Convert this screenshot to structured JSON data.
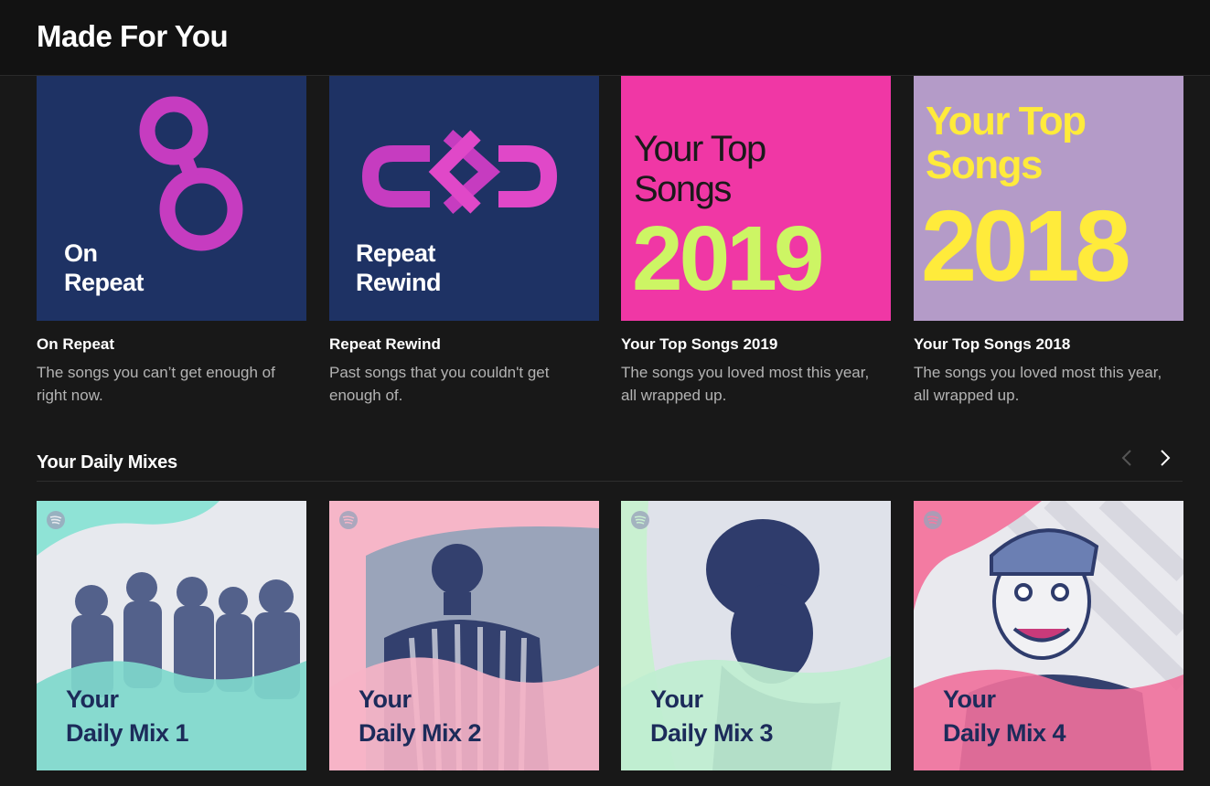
{
  "header": {
    "title": "Made For You"
  },
  "playlists": [
    {
      "title": "On Repeat",
      "description": "The songs you can’t get enough of right now.",
      "cover_line1": "On",
      "cover_line2": "Repeat"
    },
    {
      "title": "Repeat Rewind",
      "description": "Past songs that you couldn't get enough of.",
      "cover_line1": "Repeat",
      "cover_line2": "Rewind"
    },
    {
      "title": "Your Top Songs 2019",
      "description": "The songs you loved most this year, all wrapped up.",
      "cover_line1": "Your Top",
      "cover_line2": "Songs",
      "cover_year": "2019"
    },
    {
      "title": "Your Top Songs 2018",
      "description": "The songs you loved most this year, all wrapped up.",
      "cover_line1": "Your Top",
      "cover_line2": "Songs",
      "cover_year": "2018"
    }
  ],
  "daily_mixes": {
    "title": "Your Daily Mixes",
    "prev_icon": "chevron-left-icon",
    "next_icon": "chevron-right-icon",
    "items": [
      {
        "line1": "Your",
        "line2": "Daily Mix 1"
      },
      {
        "line1": "Your",
        "line2": "Daily Mix 2"
      },
      {
        "line1": "Your",
        "line2": "Daily Mix 3"
      },
      {
        "line1": "Your",
        "line2": "Daily Mix 4"
      }
    ]
  },
  "colors": {
    "background": "#181818",
    "header": "#121212",
    "on_repeat_bg": "#1e3264",
    "accent_pink": "#e03ec6",
    "top2019_bg": "#f037a5",
    "top2019_text": "#cdf564",
    "top2018_bg": "#b49bc8",
    "top2018_text": "#ffeb3b",
    "mix_navy": "#1c2b5a"
  }
}
